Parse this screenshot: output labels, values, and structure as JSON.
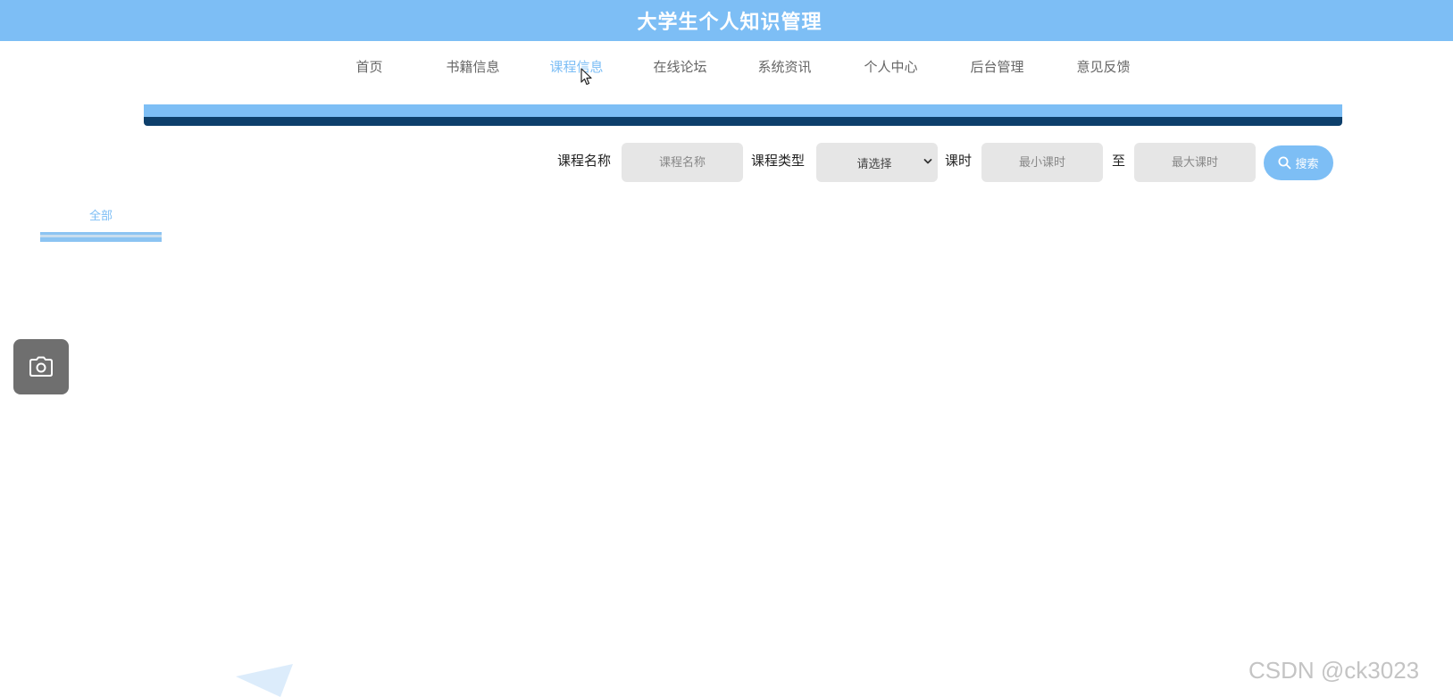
{
  "header": {
    "title": "大学生个人知识管理"
  },
  "nav": {
    "items": [
      {
        "label": "首页",
        "active": false
      },
      {
        "label": "书籍信息",
        "active": false
      },
      {
        "label": "课程信息",
        "active": true
      },
      {
        "label": "在线论坛",
        "active": false
      },
      {
        "label": "系统资讯",
        "active": false
      },
      {
        "label": "个人中心",
        "active": false
      },
      {
        "label": "后台管理",
        "active": false
      },
      {
        "label": "意见反馈",
        "active": false
      }
    ]
  },
  "search": {
    "course_name_label": "课程名称",
    "course_name_placeholder": "课程名称",
    "course_type_label": "课程类型",
    "course_type_value": "请选择",
    "hours_label": "课时",
    "min_hours_placeholder": "最小课时",
    "range_separator": "至",
    "max_hours_placeholder": "最大课时",
    "button_label": "搜索",
    "button_icon": "search-icon"
  },
  "categories": [
    {
      "label": "全部",
      "active": true
    }
  ],
  "floating": {
    "icon": "camera-icon"
  },
  "watermark": "CSDN @ck3023",
  "colors": {
    "brand": "#7dbef5",
    "dark_band": "#0d3f6b",
    "field_bg": "#e6e6e6",
    "nav_text": "#666666"
  }
}
